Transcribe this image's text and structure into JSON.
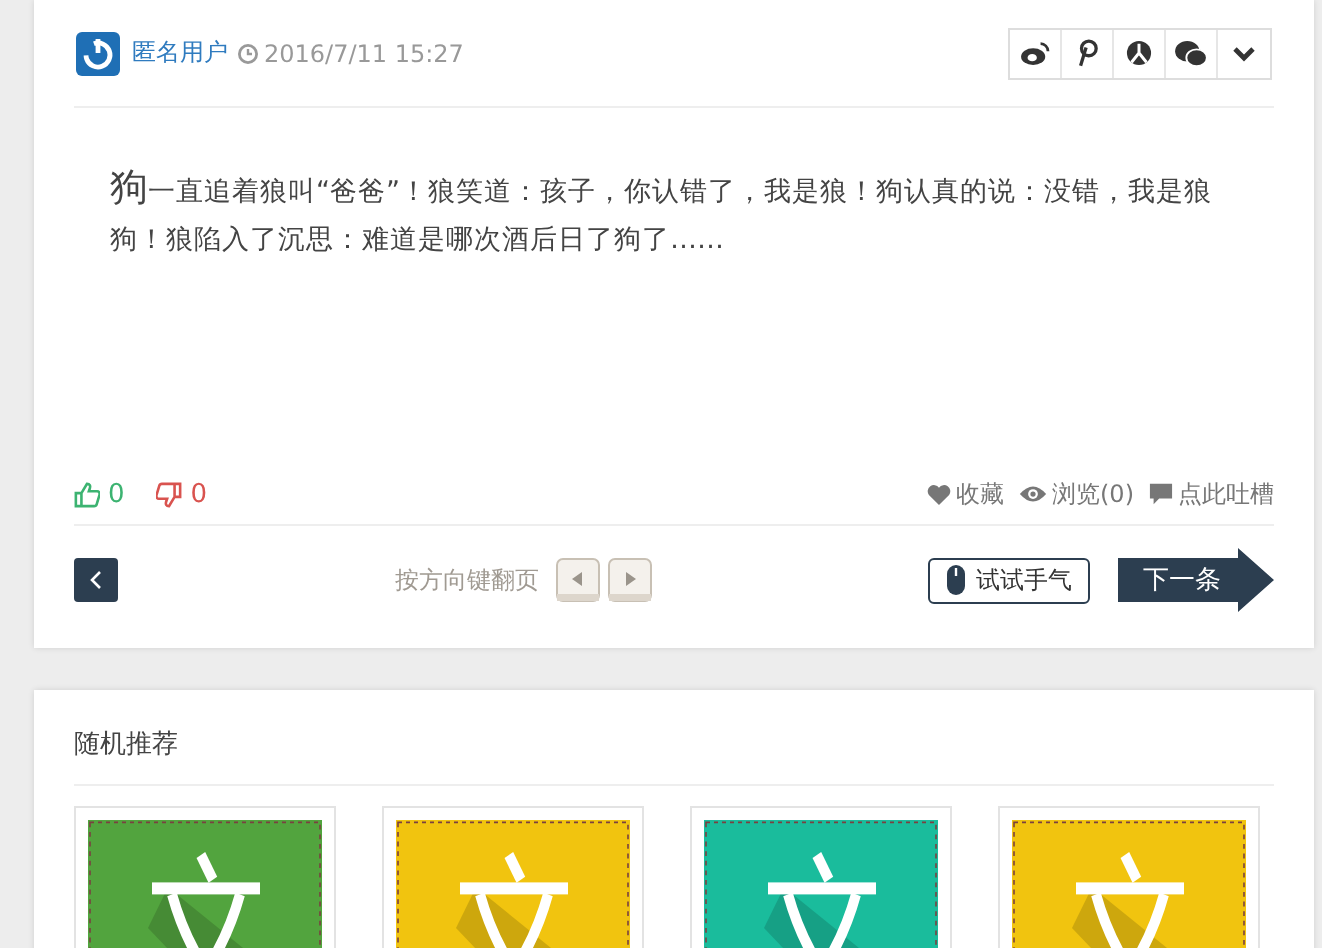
{
  "post": {
    "author": "匿名用户",
    "time": "2016/7/11 15:27",
    "share": [
      {
        "kind": "weibo"
      },
      {
        "kind": "pinterest"
      },
      {
        "kind": "renren"
      },
      {
        "kind": "wechat"
      },
      {
        "kind": "more"
      }
    ],
    "lead": "狗",
    "text": "一直追着狼叫“爸爸”！狼笑道：孩子，你认错了，我是狼！狗认真的说：没错，我是狼狗！狼陷入了沉思：难道是哪次酒后日了狗了……",
    "likes": "0",
    "dislikes": "0",
    "actions": [
      {
        "kind": "heart",
        "label": "收藏"
      },
      {
        "kind": "eye",
        "label": "浏览(0)"
      },
      {
        "kind": "comment",
        "label": "点此吐槽"
      }
    ],
    "key_hint": "按方向键翻页",
    "random_button": "试试手气",
    "next_button": "下一条"
  },
  "recommend": {
    "title": "随机推荐"
  }
}
